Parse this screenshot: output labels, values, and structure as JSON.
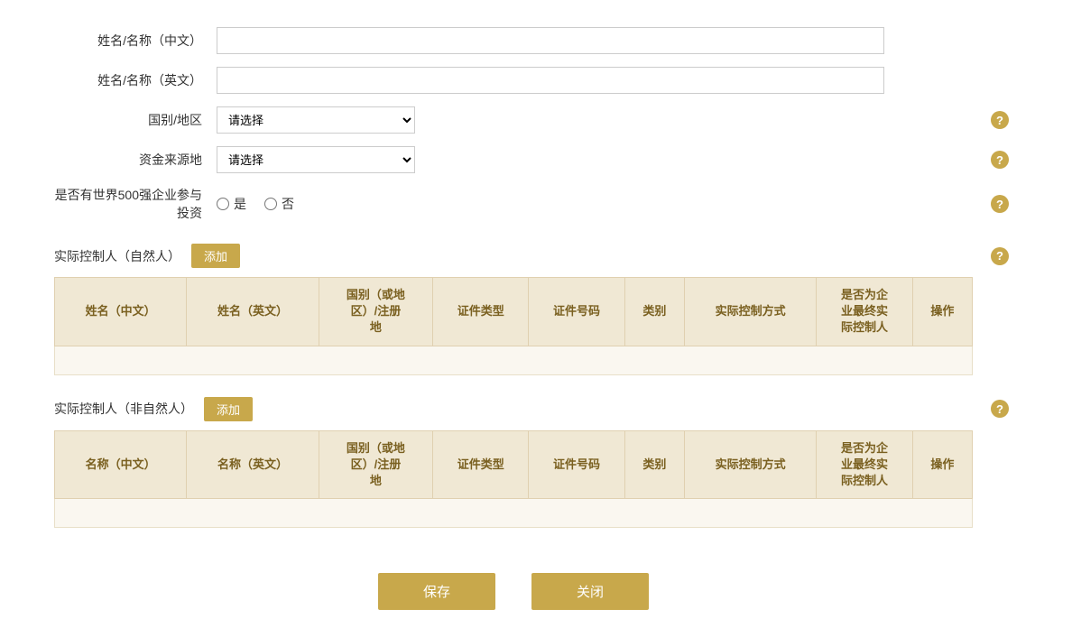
{
  "form": {
    "name_cn_label": "姓名/名称（中文）",
    "name_en_label": "姓名/名称（英文）",
    "country_label": "国别/地区",
    "country_placeholder": "请选择",
    "fund_source_label": "资金来源地",
    "fund_source_placeholder": "请选择",
    "fortune500_label": "是否有世界500强企业参与投资",
    "fortune500_yes": "是",
    "fortune500_no": "否"
  },
  "section_natural": {
    "title": "实际控制人（自然人）",
    "add_label": "添加",
    "columns": [
      "姓名（中文）",
      "姓名（英文）",
      "国别（或地区）/注册地",
      "证件类型",
      "证件号码",
      "类别",
      "实际控制方式",
      "是否为企业最终实际控制人",
      "操作"
    ]
  },
  "section_non_natural": {
    "title": "实际控制人（非自然人）",
    "add_label": "添加",
    "columns": [
      "名称（中文）",
      "名称（英文）",
      "国别（或地区）/注册地",
      "证件类型",
      "证件号码",
      "类别",
      "实际控制方式",
      "是否为企业最终实际控制人",
      "操作"
    ]
  },
  "footer": {
    "save_label": "保存",
    "close_label": "关闭"
  },
  "help_icon_text": "?"
}
